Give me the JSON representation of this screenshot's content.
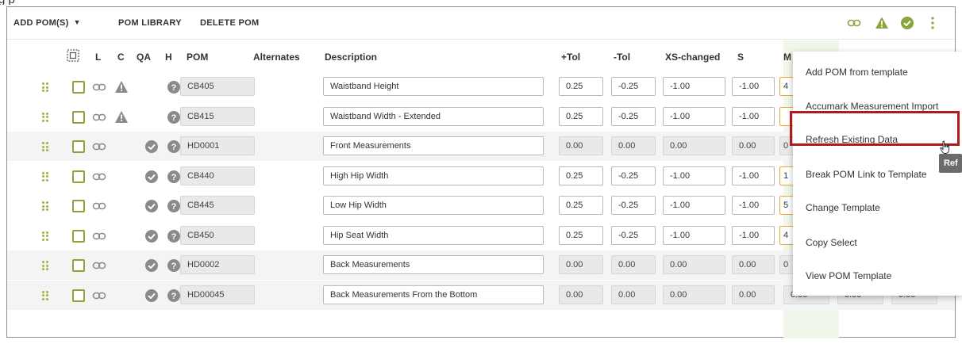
{
  "header_partial": "g                                                                      p",
  "toolbar": {
    "add_pom": "ADD POM(S)",
    "pom_library": "POM LIBRARY",
    "delete_pom": "DELETE POM"
  },
  "columns": {
    "l": "L",
    "c": "C",
    "qa": "QA",
    "h": "H",
    "pom": "POM",
    "alternates": "Alternates",
    "description": "Description",
    "plus_tol": "+Tol",
    "minus_tol": "-Tol",
    "xs_changed": "XS-changed",
    "s": "S",
    "m": "M"
  },
  "rows": [
    {
      "pom": "CB405",
      "description": "Waistband Height",
      "plus_tol": "0.25",
      "minus_tol": "-0.25",
      "xs": "-1.00",
      "s": "-1.00",
      "m": "4",
      "status": "warning",
      "editable": true
    },
    {
      "pom": "CB415",
      "description": "Waistband Width - Extended",
      "plus_tol": "0.25",
      "minus_tol": "-0.25",
      "xs": "-1.00",
      "s": "-1.00",
      "m": "",
      "status": "warning",
      "editable": true
    },
    {
      "pom": "HD0001",
      "description": "Front Measurements",
      "plus_tol": "0.00",
      "minus_tol": "0.00",
      "xs": "0.00",
      "s": "0.00",
      "m": "0",
      "status": "ok",
      "editable": false
    },
    {
      "pom": "CB440",
      "description": "High Hip Width",
      "plus_tol": "0.25",
      "minus_tol": "-0.25",
      "xs": "-1.00",
      "s": "-1.00",
      "m": "1",
      "status": "ok",
      "editable": true
    },
    {
      "pom": "CB445",
      "description": "Low Hip Width",
      "plus_tol": "0.25",
      "minus_tol": "-0.25",
      "xs": "-1.00",
      "s": "-1.00",
      "m": "5",
      "status": "ok",
      "editable": true
    },
    {
      "pom": "CB450",
      "description": "Hip Seat Width",
      "plus_tol": "0.25",
      "minus_tol": "-0.25",
      "xs": "-1.00",
      "s": "-1.00",
      "m": "4",
      "status": "ok",
      "editable": true
    },
    {
      "pom": "HD0002",
      "description": "Back Measurements",
      "plus_tol": "0.00",
      "minus_tol": "0.00",
      "xs": "0.00",
      "s": "0.00",
      "m": "0",
      "status": "ok",
      "editable": false
    },
    {
      "pom": "HD00045",
      "description": "Back Measurements From the Bottom",
      "plus_tol": "0.00",
      "minus_tol": "0.00",
      "xs": "0.00",
      "s": "0.00",
      "m": "0.00",
      "extra1": "0.00",
      "extra2": "0.00",
      "status": "ok",
      "editable": false
    }
  ],
  "menu": {
    "items": [
      "Add POM from template",
      "Accumark Measurement Import",
      "Refresh Existing Data",
      "Break POM Link to Template",
      "Change Template",
      "Copy Select",
      "View POM Template"
    ],
    "highlighted": "Refresh Existing Data",
    "tooltip": "Ref"
  },
  "colors": {
    "accent_green": "#8aa63a",
    "warning": "#8aa63a",
    "highlight_border": "#b01a1a",
    "m_column_bg": "#f1f6ea"
  }
}
